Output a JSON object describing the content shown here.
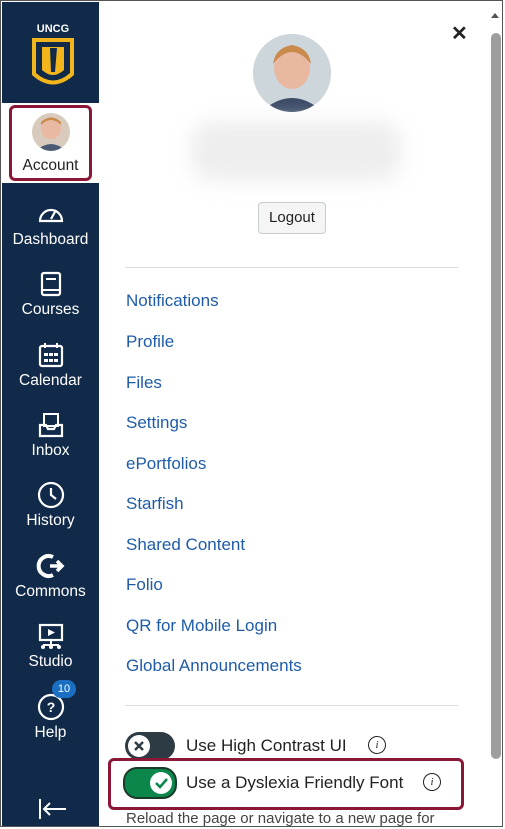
{
  "sidebar": {
    "logo_text": "UNCG",
    "account_label": "Account",
    "items": [
      {
        "label": "Dashboard",
        "icon": "dashboard-icon"
      },
      {
        "label": "Courses",
        "icon": "courses-icon"
      },
      {
        "label": "Calendar",
        "icon": "calendar-icon"
      },
      {
        "label": "Inbox",
        "icon": "inbox-icon"
      },
      {
        "label": "History",
        "icon": "history-icon"
      },
      {
        "label": "Commons",
        "icon": "commons-icon"
      },
      {
        "label": "Studio",
        "icon": "studio-icon"
      },
      {
        "label": "Help",
        "icon": "help-icon"
      }
    ],
    "help_badge": "10"
  },
  "tray": {
    "close_glyph": "✕",
    "logout_label": "Logout",
    "links": [
      "Notifications",
      "Profile",
      "Files",
      "Settings",
      "ePortfolios",
      "Starfish",
      "Shared Content",
      "Folio",
      "QR for Mobile Login",
      "Global Announcements"
    ],
    "high_contrast_label": "Use High Contrast UI",
    "dyslexia_label": "Use a Dyslexia Friendly Font",
    "high_contrast_enabled": false,
    "dyslexia_enabled": true,
    "reload_note": "Reload the page or navigate to a new page for"
  },
  "colors": {
    "sidebar_bg": "#112a4a",
    "link": "#1f5ca8",
    "highlight": "#8a1735",
    "toggle_on": "#0b874b",
    "toggle_off": "#2d3b45",
    "logo_gold": "#f2b51c"
  }
}
